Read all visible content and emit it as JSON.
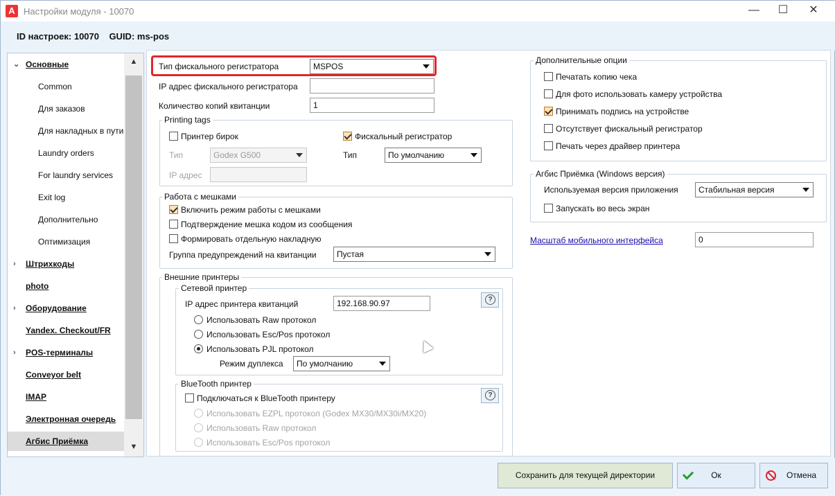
{
  "window": {
    "title": "Настройки модуля - 10070",
    "logo_letter": "A"
  },
  "header": {
    "info": "ID настроек: 10070    GUID: ms-pos"
  },
  "nav": {
    "items": [
      {
        "label": "Основные",
        "level": "top",
        "expanded": true
      },
      {
        "label": "Common",
        "level": "sub"
      },
      {
        "label": "Для заказов",
        "level": "sub"
      },
      {
        "label": "Для накладных в пути",
        "level": "sub"
      },
      {
        "label": "Laundry orders",
        "level": "sub"
      },
      {
        "label": "For laundry services",
        "level": "sub"
      },
      {
        "label": "Exit log",
        "level": "sub"
      },
      {
        "label": "Дополнительно",
        "level": "sub"
      },
      {
        "label": "Оптимизация",
        "level": "sub"
      },
      {
        "label": "Штрихкоды",
        "level": "top",
        "expandable": true
      },
      {
        "label": "photo",
        "level": "top"
      },
      {
        "label": "Оборудование",
        "level": "top",
        "expandable": true
      },
      {
        "label": "Yandex. Checkout/FR",
        "level": "top"
      },
      {
        "label": "POS-терминалы",
        "level": "top",
        "expandable": true
      },
      {
        "label": "Conveyor belt",
        "level": "top"
      },
      {
        "label": "IMAP",
        "level": "top"
      },
      {
        "label": "Электронная очередь",
        "level": "top"
      },
      {
        "label": "Агбис Приёмка",
        "level": "top",
        "selected": true
      }
    ]
  },
  "fiscal": {
    "type_label": "Тип фискального регистратора",
    "type_value": "MSPOS",
    "ip_label": "IP адрес фискального регистратора",
    "ip_value": "",
    "copies_label": "Количество копий квитанции",
    "copies_value": "1"
  },
  "printing_tags": {
    "title": "Printing tags",
    "tag_printer_label": "Принтер бирок",
    "tag_printer_checked": false,
    "type_label": "Тип",
    "type_value": "Godex G500",
    "ip_label": "IP адрес",
    "ip_value": "",
    "fiscal_label": "Фискальный регистратор",
    "fiscal_checked": true,
    "fiscal_type_label": "Тип",
    "fiscal_type_value": "По умолчанию"
  },
  "bags": {
    "title": "Работа с мешками",
    "enable_label": "Включить режим работы с мешками",
    "confirm_label": "Подтверждение мешка кодом из сообщения",
    "separate_label": "Формировать отдельную накладную",
    "warn_group_label": "Группа предупреждений на квитанции",
    "warn_group_value": "Пустая"
  },
  "external_printers": {
    "title": "Внешние принтеры",
    "network": {
      "title": "Сетевой принтер",
      "ip_label": "IP адрес принтера квитанций",
      "ip_value": "192.168.90.97",
      "raw_label": "Использовать Raw протокол",
      "escpos_label": "Использовать Esc/Pos протокол",
      "pjl_label": "Использовать PJL протокол",
      "duplex_label": "Режим дуплекса",
      "duplex_value": "По умолчанию",
      "help": "?"
    },
    "bluetooth": {
      "title": "BlueTooth принтер",
      "connect_label": "Подключаться к BlueTooth принтеру",
      "ezpl_label": "Использовать EZPL протокол (Godex MX30/MX30i/MX20)",
      "raw_label": "Использовать Raw протокол",
      "escpos_label": "Использовать Esc/Pos протокол",
      "help": "?"
    }
  },
  "extra_options": {
    "title": "Дополнительные опции",
    "print_copy_label": "Печатать копию чека",
    "camera_label": "Для фото использовать камеру устройства",
    "signature_label": "Принимать подпись на устройстве",
    "no_fiscal_label": "Отсутствует фискальный регистратор",
    "driver_print_label": "Печать через драйвер принтера"
  },
  "agbis_windows": {
    "title": "Агбис Приёмка (Windows версия)",
    "version_label": "Используемая версия приложения",
    "version_value": "Стабильная версия",
    "fullscreen_label": "Запускать во весь экран"
  },
  "mobile_scale": {
    "label": "Масштаб мобильного интерфейса",
    "value": "0"
  },
  "footer": {
    "save_label": "Сохранить для текущей директории",
    "ok_label": "Ок",
    "cancel_label": "Отмена"
  }
}
